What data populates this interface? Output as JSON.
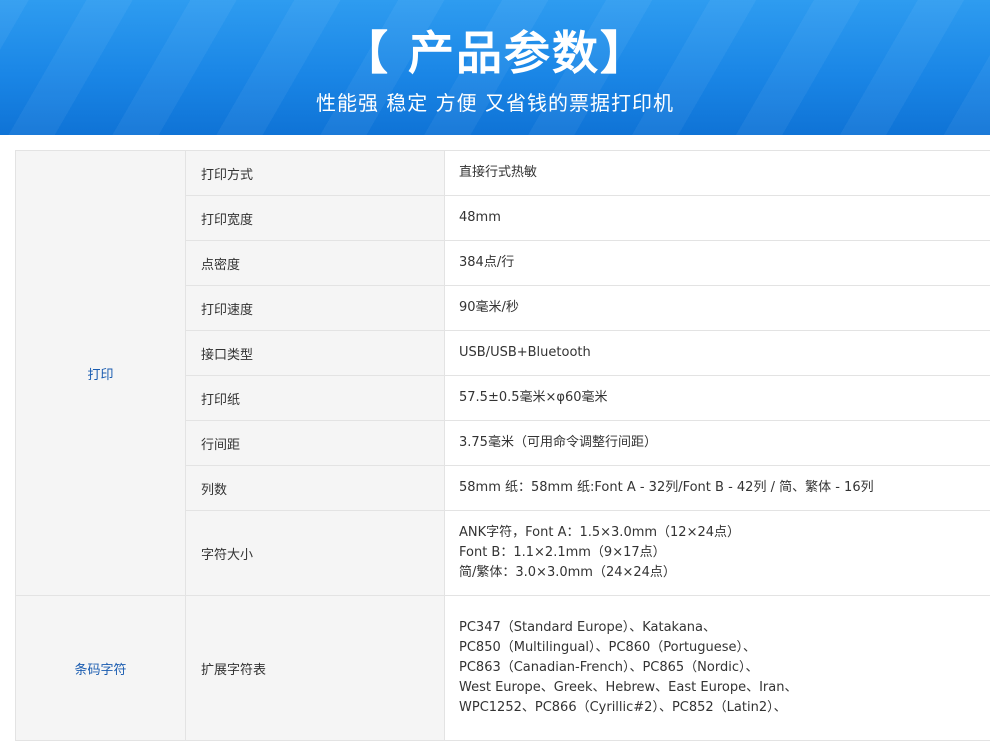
{
  "banner": {
    "title": "【 产品参数】",
    "subtitle": "性能强 稳定 方便 又省钱的票据打印机"
  },
  "groups": [
    {
      "name": "打印",
      "rows": [
        {
          "label": "打印方式",
          "lines": [
            "直接行式热敏"
          ]
        },
        {
          "label": "打印宽度",
          "lines": [
            "48mm"
          ]
        },
        {
          "label": "点密度",
          "lines": [
            "384点/行"
          ]
        },
        {
          "label": "打印速度",
          "lines": [
            "90毫米/秒"
          ]
        },
        {
          "label": "接口类型",
          "lines": [
            "USB/USB+Bluetooth"
          ]
        },
        {
          "label": "打印纸",
          "lines": [
            "57.5±0.5毫米×φ60毫米"
          ]
        },
        {
          "label": "行间距",
          "lines": [
            "3.75毫米（可用命令调整行间距）"
          ]
        },
        {
          "label": "列数",
          "lines": [
            "58mm 纸：58mm 纸:Font A - 32列/Font B - 42列 / 简、繁体 - 16列"
          ]
        },
        {
          "label": "字符大小",
          "lines": [
            "ANK字符，Font A：1.5×3.0mm（12×24点）",
            "Font B：1.1×2.1mm（9×17点）",
            "简/繁体：3.0×3.0mm（24×24点）"
          ]
        }
      ]
    },
    {
      "name": "条码字符",
      "rows": [
        {
          "label": "扩展字符表",
          "lines": [
            "PC347（Standard Europe）、Katakana、",
            "PC850（Multilingual）、PC860（Portuguese）、",
            "PC863（Canadian-French）、PC865（Nordic）、",
            "West Europe、Greek、Hebrew、East Europe、Iran、",
            "WPC1252、PC866（Cyrillic#2）、PC852（Latin2）、"
          ]
        }
      ]
    }
  ]
}
